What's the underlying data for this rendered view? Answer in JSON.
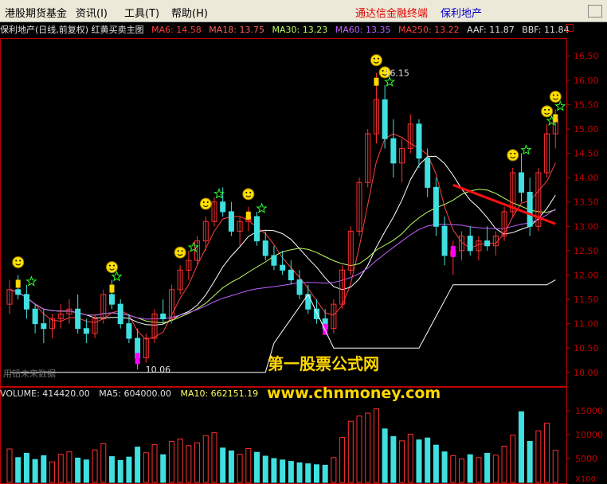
{
  "menu": {
    "items": [
      "港股期货基金",
      "资讯(I)",
      "工具(T)",
      "帮助(H)"
    ],
    "brand": "通达信金融终端",
    "stock": "保利地产"
  },
  "indicator_bar": {
    "title": "保利地产(日线,前复权) 红黄买卖主图",
    "ma": [
      {
        "label": "MA6: 14.58",
        "color": "#ff4040"
      },
      {
        "label": "MA18: 13.75",
        "color": "#ff6060"
      },
      {
        "label": "MA30: 13.23",
        "color": "#c0ff60"
      },
      {
        "label": "MA60: 13.35",
        "color": "#c060ff"
      },
      {
        "label": "MA250: 13.22",
        "color": "#ff4040"
      },
      {
        "label": "AAF: 11.87",
        "color": "#e0e0e0"
      },
      {
        "label": "BBF: 11.84",
        "color": "#e0e0e0"
      }
    ]
  },
  "price_axis": [
    "16.50",
    "16.00",
    "15.50",
    "15.00",
    "14.50",
    "14.00",
    "13.50",
    "13.00",
    "12.50",
    "12.00",
    "11.50",
    "11.00",
    "10.50",
    "10.00"
  ],
  "volume_axis": [
    "15000",
    "10000",
    "5000"
  ],
  "volume_axis_footer": "X100",
  "annotations": {
    "high": "16.15",
    "low": "10.06",
    "watermark_left": "用铅未来数据",
    "site_name": "第一股票公式网",
    "site_url": "www.chnmoney.com"
  },
  "volume_bar": [
    {
      "label": "VOLUME: 414420.00",
      "color": "#e0e0e0"
    },
    {
      "label": "MA5: 604000.00",
      "color": "#e0e0e0"
    },
    {
      "label": "MA10: 662151.19",
      "color": "#ffff60"
    }
  ],
  "colors": {
    "up": "#ff3030",
    "down": "#40e0e0",
    "axis": "#c00000",
    "signal_yellow": "#ffd700",
    "signal_magenta": "#ff00ff"
  },
  "chart_data": {
    "type": "candlestick",
    "price_range": [
      9.8,
      16.7
    ],
    "volume_range": [
      0,
      17000
    ],
    "candles": [
      [
        11.4,
        11.9,
        11.2,
        11.7
      ],
      [
        11.7,
        12.0,
        11.5,
        11.6
      ],
      [
        11.6,
        11.8,
        11.1,
        11.3
      ],
      [
        11.3,
        11.4,
        10.8,
        11.0
      ],
      [
        11.0,
        11.3,
        10.6,
        10.9
      ],
      [
        10.9,
        11.2,
        10.7,
        11.1
      ],
      [
        11.1,
        11.4,
        10.9,
        11.2
      ],
      [
        11.2,
        11.5,
        11.0,
        11.3
      ],
      [
        11.3,
        11.6,
        10.8,
        10.9
      ],
      [
        10.9,
        11.1,
        10.6,
        10.8
      ],
      [
        10.8,
        11.2,
        10.7,
        11.1
      ],
      [
        11.1,
        11.7,
        11.0,
        11.6
      ],
      [
        11.6,
        11.9,
        11.3,
        11.4
      ],
      [
        11.4,
        11.5,
        10.9,
        11.0
      ],
      [
        11.0,
        11.2,
        10.6,
        10.7
      ],
      [
        10.7,
        10.9,
        10.06,
        10.3
      ],
      [
        10.3,
        10.8,
        10.2,
        10.7
      ],
      [
        10.7,
        11.3,
        10.6,
        11.2
      ],
      [
        11.2,
        11.5,
        11.0,
        11.1
      ],
      [
        11.1,
        11.8,
        11.0,
        11.7
      ],
      [
        11.7,
        12.2,
        11.6,
        12.1
      ],
      [
        12.1,
        12.5,
        11.9,
        12.3
      ],
      [
        12.3,
        12.8,
        12.2,
        12.7
      ],
      [
        12.7,
        13.2,
        12.5,
        13.1
      ],
      [
        13.1,
        13.6,
        13.0,
        13.5
      ],
      [
        13.5,
        13.8,
        13.2,
        13.3
      ],
      [
        13.3,
        13.5,
        12.8,
        12.9
      ],
      [
        12.9,
        13.2,
        12.6,
        13.1
      ],
      [
        13.1,
        13.4,
        12.9,
        13.2
      ],
      [
        13.2,
        13.3,
        12.6,
        12.7
      ],
      [
        12.7,
        12.9,
        12.3,
        12.4
      ],
      [
        12.4,
        12.6,
        12.1,
        12.2
      ],
      [
        12.2,
        12.5,
        12.0,
        12.1
      ],
      [
        12.1,
        12.3,
        11.8,
        11.9
      ],
      [
        11.9,
        12.1,
        11.5,
        11.6
      ],
      [
        11.6,
        11.8,
        11.2,
        11.3
      ],
      [
        11.3,
        11.5,
        11.0,
        11.1
      ],
      [
        11.1,
        11.3,
        10.8,
        10.9
      ],
      [
        10.9,
        11.5,
        10.8,
        11.4
      ],
      [
        11.4,
        12.2,
        11.3,
        12.1
      ],
      [
        12.1,
        13.0,
        12.0,
        12.9
      ],
      [
        12.9,
        14.0,
        12.8,
        13.9
      ],
      [
        13.9,
        15.0,
        13.8,
        14.9
      ],
      [
        14.9,
        16.15,
        14.7,
        15.6
      ],
      [
        15.6,
        15.9,
        14.6,
        14.8
      ],
      [
        14.8,
        15.2,
        14.0,
        14.3
      ],
      [
        14.3,
        14.8,
        13.9,
        14.6
      ],
      [
        14.6,
        15.3,
        14.5,
        15.1
      ],
      [
        15.1,
        15.2,
        14.2,
        14.4
      ],
      [
        14.4,
        14.6,
        13.6,
        13.8
      ],
      [
        13.8,
        14.0,
        12.8,
        13.0
      ],
      [
        13.0,
        13.2,
        12.2,
        12.4
      ],
      [
        12.4,
        12.7,
        12.0,
        12.5
      ],
      [
        12.5,
        12.9,
        12.3,
        12.8
      ],
      [
        12.8,
        13.0,
        12.4,
        12.5
      ],
      [
        12.5,
        12.8,
        12.3,
        12.7
      ],
      [
        12.7,
        13.0,
        12.5,
        12.6
      ],
      [
        12.6,
        12.9,
        12.4,
        12.8
      ],
      [
        12.8,
        13.4,
        12.7,
        13.3
      ],
      [
        13.3,
        14.2,
        13.2,
        14.1
      ],
      [
        14.1,
        14.5,
        13.5,
        13.7
      ],
      [
        13.7,
        14.0,
        12.8,
        13.0
      ],
      [
        13.0,
        14.2,
        12.9,
        14.1
      ],
      [
        14.1,
        15.1,
        14.0,
        14.9
      ],
      [
        14.9,
        15.4,
        14.6,
        15.2
      ]
    ],
    "volume": [
      7000,
      5200,
      6100,
      4800,
      5600,
      4300,
      5900,
      6400,
      5100,
      4700,
      6800,
      8100,
      5400,
      4600,
      5300,
      7400,
      6200,
      7900,
      5800,
      8600,
      9100,
      7700,
      8300,
      9800,
      10400,
      7200,
      6600,
      5900,
      7100,
      6300,
      5500,
      5000,
      4700,
      4400,
      4100,
      3900,
      3700,
      3600,
      5200,
      9400,
      12800,
      13900,
      14500,
      15400,
      11200,
      9600,
      8700,
      10100,
      8900,
      9300,
      7800,
      6400,
      5600,
      4900,
      5800,
      5200,
      6100,
      5700,
      7600,
      9900,
      14800,
      8600,
      10800,
      12400,
      6700
    ]
  }
}
